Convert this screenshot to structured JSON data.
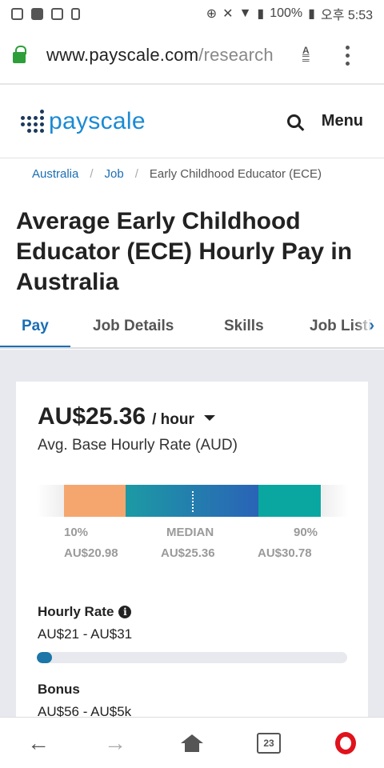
{
  "status_bar": {
    "battery": "100%",
    "time": "오후 5:53"
  },
  "browser": {
    "url_host": "www.payscale.com",
    "url_path": "/research",
    "bottom_nav": {
      "tab_count": "23"
    }
  },
  "site_header": {
    "logo": "payscale",
    "menu_label": "Menu",
    "icons": [
      "search-icon"
    ]
  },
  "breadcrumb": [
    {
      "label": "Australia",
      "link": true
    },
    {
      "label": "Job",
      "link": true
    },
    {
      "label": "Early Childhood Educator (ECE)",
      "link": false
    }
  ],
  "page_title": "Average Early Childhood Educator (ECE) Hourly Pay in Australia",
  "tabs": [
    {
      "label": "Pay",
      "active": true
    },
    {
      "label": "Job Details",
      "active": false
    },
    {
      "label": "Skills",
      "active": false
    },
    {
      "label": "Job Listings",
      "active": false
    }
  ],
  "pay_card": {
    "rate_value": "AU$25.36",
    "rate_unit": "/ hour",
    "rate_subtitle": "Avg. Base Hourly Rate (AUD)",
    "range": {
      "p10_label": "10%",
      "p10_value": "AU$20.98",
      "median_label": "MEDIAN",
      "median_value": "AU$25.36",
      "p90_label": "90%",
      "p90_value": "AU$30.78"
    },
    "hourly_rate": {
      "title": "Hourly Rate",
      "range": "AU$21 - AU$31",
      "bar_fraction": 0.05
    },
    "bonus": {
      "title": "Bonus",
      "range": "AU$56 - AU$5k"
    }
  },
  "colors": {
    "link_blue": "#1a6eb4",
    "p10_orange": "#f5a66e",
    "p90_teal": "#0aa7a0",
    "opera_red": "#e0121c"
  }
}
